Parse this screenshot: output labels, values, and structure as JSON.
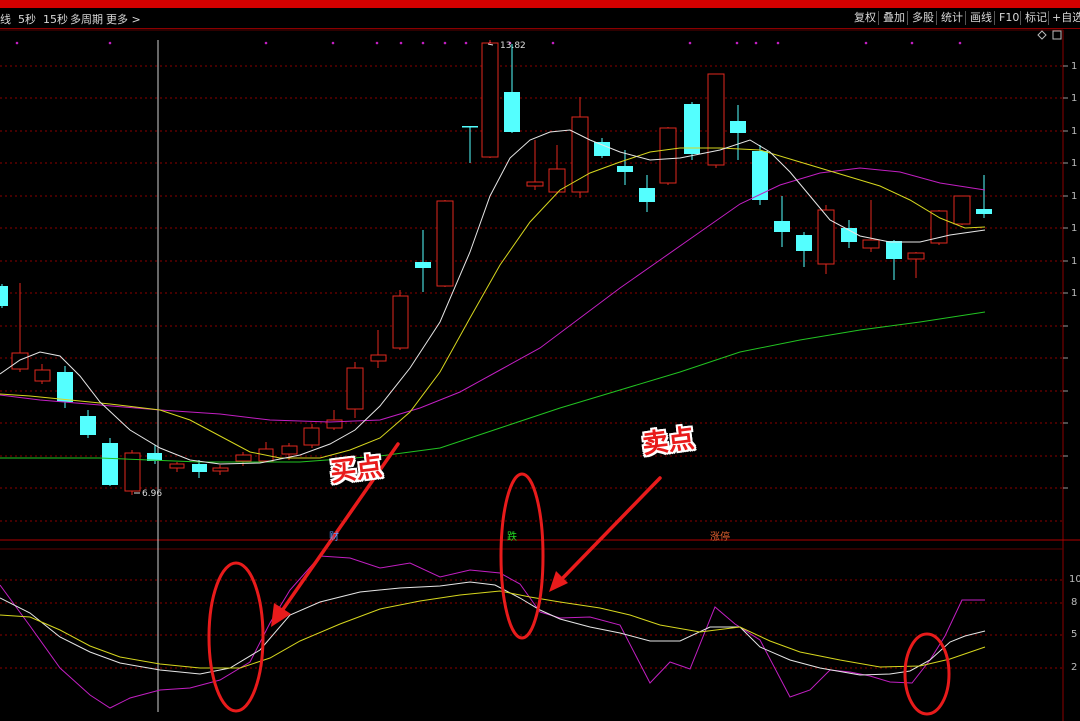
{
  "toolbar": {
    "left": [
      {
        "label": "线"
      },
      {
        "label": "5秒"
      },
      {
        "label": "15秒"
      },
      {
        "label": "多周期"
      },
      {
        "label": "更多 >"
      }
    ],
    "right": [
      {
        "label": "复权"
      },
      {
        "label": "叠加"
      },
      {
        "label": "多股"
      },
      {
        "label": "统计"
      },
      {
        "label": "画线"
      },
      {
        "label": "F10"
      },
      {
        "label": "标记"
      },
      {
        "label": "+自选"
      }
    ]
  },
  "chart_labels": {
    "high_price": "13.82",
    "low_price": "6.96"
  },
  "event_labels": {
    "e1": "财",
    "e2": "跌",
    "e3": "涨停"
  },
  "annotations": {
    "buy": "买点",
    "sell": "卖点"
  },
  "indicator_axis": [
    "10",
    "8",
    "5",
    "2"
  ],
  "colors": {
    "up_candle": "#e0281e",
    "down_candle": "#54ffff",
    "ma_white": "#e6e6e6",
    "ma_yellow": "#d6d61e",
    "ma_magenta": "#c21fc2",
    "ma_green": "#22c322",
    "annotation_red": "#e81b1b",
    "grid": "#8b0000"
  },
  "icons": [
    "arrow-left-icon",
    "dot-marker-icon",
    "diamond-icon",
    "window-icon"
  ]
}
